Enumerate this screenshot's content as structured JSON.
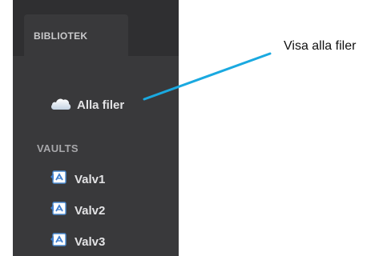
{
  "sidebar": {
    "tab_label": "BIBLIOTEK",
    "all_files": {
      "label": "Alla filer",
      "icon": "cloud-icon"
    },
    "vaults_header": "VAULTS",
    "vaults": [
      {
        "label": "Valv1",
        "icon": "vault-icon"
      },
      {
        "label": "Valv2",
        "icon": "vault-icon"
      },
      {
        "label": "Valv3",
        "icon": "vault-icon"
      }
    ]
  },
  "callout": {
    "text": "Visa alla filer",
    "line_color": "#1aa9e0"
  },
  "colors": {
    "sidebar_bg": "#39393b",
    "topstrip_bg": "#2f2f31",
    "item_text": "#e3e3e5",
    "header_text": "#a7a7aa"
  }
}
